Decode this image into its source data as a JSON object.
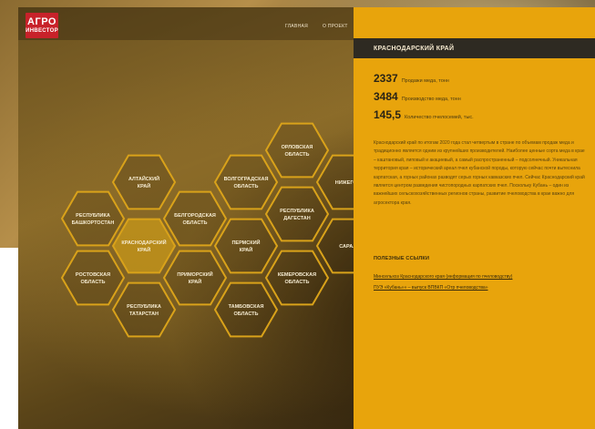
{
  "header": {
    "logo_line1": "АГРО",
    "logo_line2": "ИНВЕСТОР",
    "nav": [
      "ГЛАВНАЯ",
      "О ПРОЕКТ"
    ]
  },
  "regions": [
    {
      "name": "Алтайский\nкрай"
    },
    {
      "name": "Республика\nБашкортостан"
    },
    {
      "name": "Краснодарский\nкрай",
      "active": true
    },
    {
      "name": "Ростовская\nобласть"
    },
    {
      "name": "Республика\nТатарстан"
    },
    {
      "name": "Белгородская\nобласть"
    },
    {
      "name": "Приморский\nкрай"
    },
    {
      "name": "Волгоградская\nобласть"
    },
    {
      "name": "Пермский\nкрай"
    },
    {
      "name": "Тамбовская\nобласть"
    },
    {
      "name": "Орловская\nобласть"
    },
    {
      "name": "Республика\nДагестан"
    },
    {
      "name": "Кемеровская\nобласть"
    },
    {
      "name": "Нижего..."
    },
    {
      "name": "Сара..."
    }
  ],
  "panel": {
    "title": "КРАСНОДАРСКИЙ КРАЙ",
    "stats": [
      {
        "value": "2337",
        "label": "Продажи меда, тонн"
      },
      {
        "value": "3484",
        "label": "Производство меда, тонн"
      },
      {
        "value": "145,5",
        "label": "Количество пчелосемей, тыс."
      }
    ],
    "description": "Краснодарский край по итогам 2020 года стал четвертым в стране по объемам продаж меда и традиционно является одним из крупнейших производителей. Наиболее ценные сорта меда в крае – каштановый, липовый и акациевый, а самый распространенный – подсолнечный. Уникальная территория края – исторический ареал пчел кубанской породы, которую сейчас почти вытеснила карпатская, а горных районах разводят серых горных кавказских пчел. Сейчас Краснодарский край является центром разведения чистопородных карпатских пчел. Поскольку Кубань – один из важнейших сельскохозяйственных регионов страны, развитие пчеловодства в крае важно для агросектора края.",
    "links_title": "ПОЛЕЗНЫЕ ССЫЛКИ",
    "links": [
      "Минсельхоз Краснодарского края (информация по пчеловодству)",
      "ПУЭ «Кубань»» – выпуск ВПВКП «Отр пчеловодства»"
    ]
  },
  "colors": {
    "panel_bg": "#e8a40c",
    "panel_head_bg": "#2e2a22",
    "hex_stroke": "#d9a21a",
    "active_hex_fill": "#c8981a",
    "logo_red": "#c8222a"
  }
}
